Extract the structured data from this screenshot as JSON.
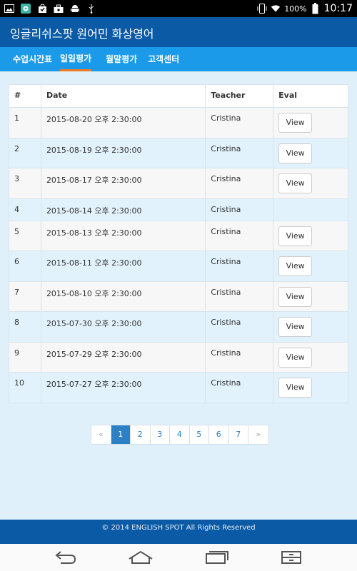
{
  "status_bar": {
    "battery": "100%",
    "time": "10:17"
  },
  "app": {
    "title": "잉글리쉬스팟 원어민 화상영어"
  },
  "tabs": [
    {
      "label": "수업시간표",
      "active": false
    },
    {
      "label": "일일평가",
      "active": true
    },
    {
      "label": "월말평가",
      "active": false
    },
    {
      "label": "고객센터",
      "active": false
    }
  ],
  "table": {
    "headers": [
      "#",
      "Date",
      "Teacher",
      "Eval"
    ],
    "rows": [
      {
        "num": "1",
        "date": "2015-08-20 오후 2:30:00",
        "teacher": "Cristina",
        "eval": "View"
      },
      {
        "num": "2",
        "date": "2015-08-19 오후 2:30:00",
        "teacher": "Cristina",
        "eval": "View"
      },
      {
        "num": "3",
        "date": "2015-08-17 오후 2:30:00",
        "teacher": "Cristina",
        "eval": "View"
      },
      {
        "num": "4",
        "date": "2015-08-14 오후 2:30:00",
        "teacher": "Cristina",
        "eval": ""
      },
      {
        "num": "5",
        "date": "2015-08-13 오후 2:30:00",
        "teacher": "Cristina",
        "eval": "View"
      },
      {
        "num": "6",
        "date": "2015-08-11 오후 2:30:00",
        "teacher": "Cristina",
        "eval": "View"
      },
      {
        "num": "7",
        "date": "2015-08-10 오후 2:30:00",
        "teacher": "Cristina",
        "eval": "View"
      },
      {
        "num": "8",
        "date": "2015-07-30 오후 2:30:00",
        "teacher": "Cristina",
        "eval": "View"
      },
      {
        "num": "9",
        "date": "2015-07-29 오후 2:30:00",
        "teacher": "Cristina",
        "eval": "View"
      },
      {
        "num": "10",
        "date": "2015-07-27 오후 2:30:00",
        "teacher": "Cristina",
        "eval": "View"
      }
    ]
  },
  "pagination": {
    "prev": "«",
    "pages": [
      "1",
      "2",
      "3",
      "4",
      "5",
      "6",
      "7"
    ],
    "current": "1",
    "next": "»"
  },
  "footer": {
    "text": "© 2014 ENGLISH SPOT All Rights Reserved"
  },
  "colors": {
    "header": "#0b5aa6",
    "tabbar": "#1a9ae8",
    "active_tab_underline": "#f47a1f",
    "content_bg": "#dff0fb",
    "page_active": "#2b80c6"
  },
  "icons": {
    "status_left": [
      "gallery-icon",
      "app-icon",
      "shopping-bag-icon",
      "briefcase-icon",
      "android-icon",
      "usb-icon"
    ],
    "status_right": [
      "vibrate-icon",
      "wifi-icon",
      "battery-icon"
    ],
    "nav": [
      "back-icon",
      "home-icon",
      "recent-apps-icon",
      "screenshot-icon"
    ]
  }
}
